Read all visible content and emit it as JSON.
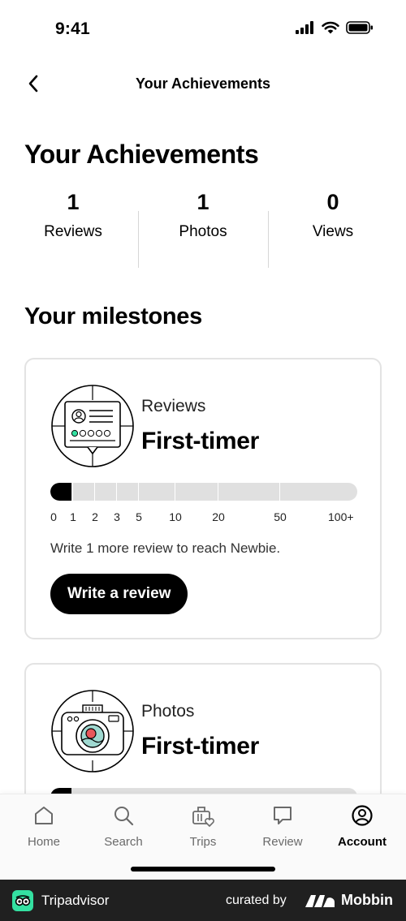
{
  "status_bar": {
    "time": "9:41"
  },
  "nav": {
    "title": "Your Achievements"
  },
  "page": {
    "title": "Your Achievements"
  },
  "stats": [
    {
      "value": "1",
      "label": "Reviews"
    },
    {
      "value": "1",
      "label": "Photos"
    },
    {
      "value": "0",
      "label": "Views"
    }
  ],
  "milestones": {
    "title": "Your milestones",
    "cards": [
      {
        "kicker": "Reviews",
        "level": "First-timer",
        "progress_value": 1,
        "ticks": [
          "0",
          "1",
          "2",
          "3",
          "5",
          "10",
          "20",
          "50",
          "100+"
        ],
        "hint": "Write 1 more review to reach Newbie.",
        "cta": "Write a review"
      },
      {
        "kicker": "Photos",
        "level": "First-timer"
      }
    ]
  },
  "tabs": [
    {
      "label": "Home",
      "icon": "house-icon"
    },
    {
      "label": "Search",
      "icon": "search-icon"
    },
    {
      "label": "Trips",
      "icon": "suitcase-heart-icon"
    },
    {
      "label": "Review",
      "icon": "speech-bubble-icon"
    },
    {
      "label": "Account",
      "icon": "user-circle-icon",
      "active": true
    }
  ],
  "footer": {
    "brand": "Tripadvisor",
    "curated_by": "curated by",
    "curator": "Mobbin"
  },
  "colors": {
    "accent": "#000000",
    "progress_track": "#e0e0e0",
    "brand_green": "#34e0a1",
    "badge_red": "#e8575b",
    "badge_teal": "#9fd8d0"
  }
}
